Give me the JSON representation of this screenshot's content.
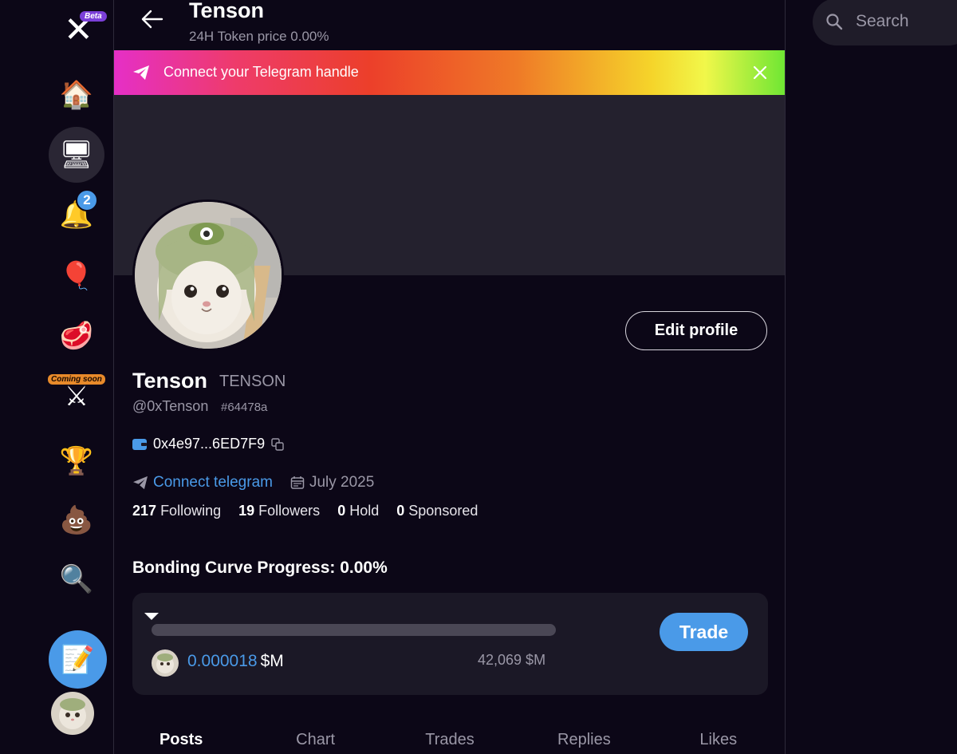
{
  "rail": {
    "beta_label": "Beta",
    "notification_count": "2",
    "coming_soon_label": "Coming soon",
    "items": [
      {
        "name": "home-icon",
        "glyph": "🏠"
      },
      {
        "name": "terminal-icon",
        "glyph": "🖥"
      },
      {
        "name": "bell-icon",
        "glyph": "🔔"
      },
      {
        "name": "balloon-icon",
        "glyph": "🎈"
      },
      {
        "name": "meat-icon",
        "glyph": "🥩"
      },
      {
        "name": "swords-icon",
        "glyph": "⚔"
      },
      {
        "name": "podium-icon",
        "glyph": "🏆"
      },
      {
        "name": "poop-icon",
        "glyph": "💩"
      },
      {
        "name": "magnifier-icon",
        "glyph": "🔍"
      }
    ],
    "compose_glyph": "📝"
  },
  "header": {
    "title": "Tenson",
    "subtitle_label": "24H Token price",
    "subtitle_value": "0.00%"
  },
  "banner": {
    "text": "Connect your Telegram handle"
  },
  "profile": {
    "edit_label": "Edit profile",
    "name": "Tenson",
    "ticker": "TENSON",
    "handle": "@0xTenson",
    "hash": "#64478a",
    "wallet": "0x4e97...6ED7F9",
    "connect_telegram": "Connect telegram",
    "joined": "July 2025",
    "stats": [
      {
        "value": "217",
        "label": "Following"
      },
      {
        "value": "19",
        "label": "Followers"
      },
      {
        "value": "0",
        "label": "Hold"
      },
      {
        "value": "0",
        "label": "Sponsored"
      }
    ]
  },
  "bonding": {
    "title": "Bonding Curve Progress: 0.00%",
    "progress": 0.0,
    "price": "0.000018",
    "price_unit": "$M",
    "market_cap": "42,069 $M",
    "trade_label": "Trade"
  },
  "tabs": [
    {
      "label": "Posts",
      "active": true
    },
    {
      "label": "Chart",
      "active": false
    },
    {
      "label": "Trades",
      "active": false
    },
    {
      "label": "Replies",
      "active": false
    },
    {
      "label": "Likes",
      "active": false
    }
  ],
  "search": {
    "placeholder": "Search"
  },
  "colors": {
    "accent": "#4a9ae8",
    "background": "#0c0717",
    "muted": "#9a97a6"
  }
}
